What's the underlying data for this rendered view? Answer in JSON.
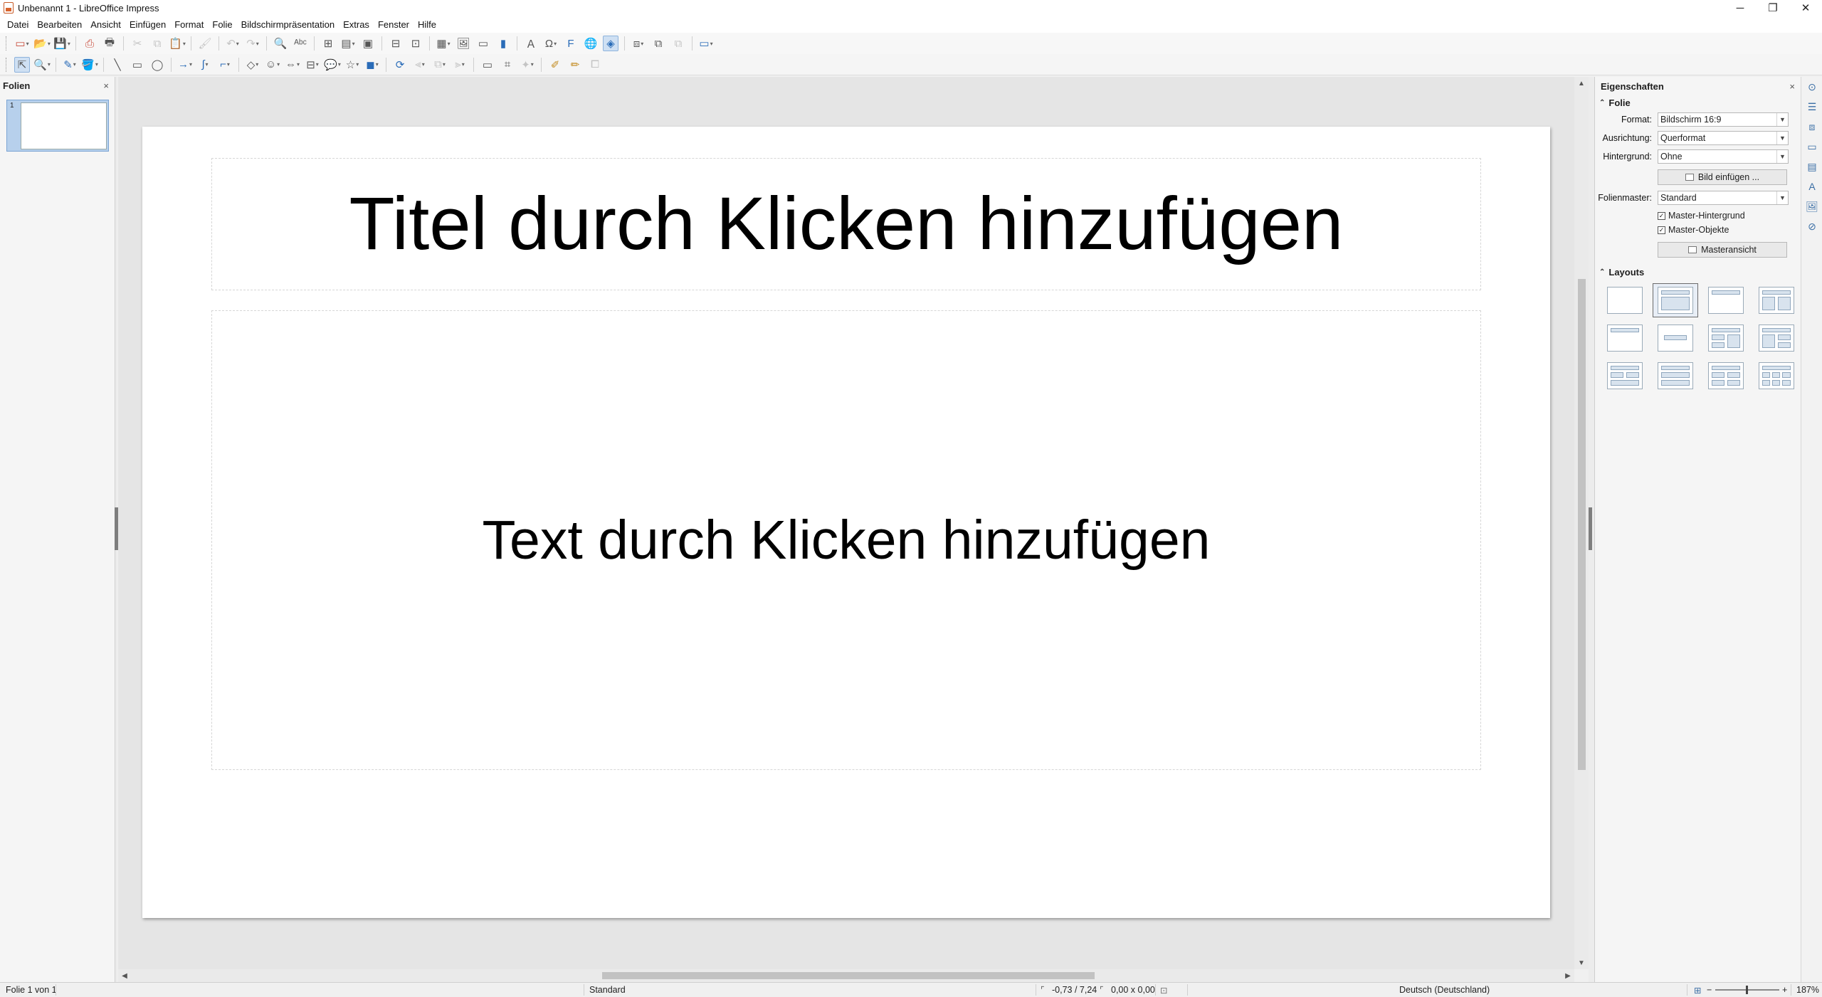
{
  "window": {
    "title": "Unbenannt 1 - LibreOffice Impress",
    "buttons": {
      "minimize": "─",
      "maximize": "❐",
      "close": "✕"
    }
  },
  "menu": [
    "Datei",
    "Bearbeiten",
    "Ansicht",
    "Einfügen",
    "Format",
    "Folie",
    "Bildschirmpräsentation",
    "Extras",
    "Fenster",
    "Hilfe"
  ],
  "slides_pane": {
    "title": "Folien",
    "close": "×",
    "slides": [
      {
        "number": "1"
      }
    ]
  },
  "slide": {
    "title_placeholder": "Titel durch Klicken hinzufügen",
    "content_placeholder": "Text durch Klicken hinzufügen"
  },
  "sidebar": {
    "title": "Eigenschaften",
    "close": "×",
    "slide_section": {
      "title": "Folie",
      "format_label": "Format:",
      "format_value": "Bildschirm 16:9",
      "orientation_label": "Ausrichtung:",
      "orientation_value": "Querformat",
      "background_label": "Hintergrund:",
      "background_value": "Ohne",
      "insert_image_button": "Bild einfügen ...",
      "master_label": "Folienmaster:",
      "master_value": "Standard",
      "master_background_checkbox": "Master-Hintergrund",
      "master_objects_checkbox": "Master-Objekte",
      "master_view_button": "Masteransicht",
      "master_background_checked": true,
      "master_objects_checked": true
    },
    "layouts_section": {
      "title": "Layouts",
      "selected_index": 1
    }
  },
  "statusbar": {
    "slide_info": "Folie 1 von 1",
    "master": "Standard",
    "position": "-0,73 / 7,24",
    "size": "0,00 x 0,00",
    "language": "Deutsch (Deutschland)",
    "zoom": "187%",
    "zoom_minus": "−",
    "zoom_plus": "+"
  },
  "colors": {
    "accent": "#2a6cb8",
    "selection": "#b7d0ec"
  }
}
